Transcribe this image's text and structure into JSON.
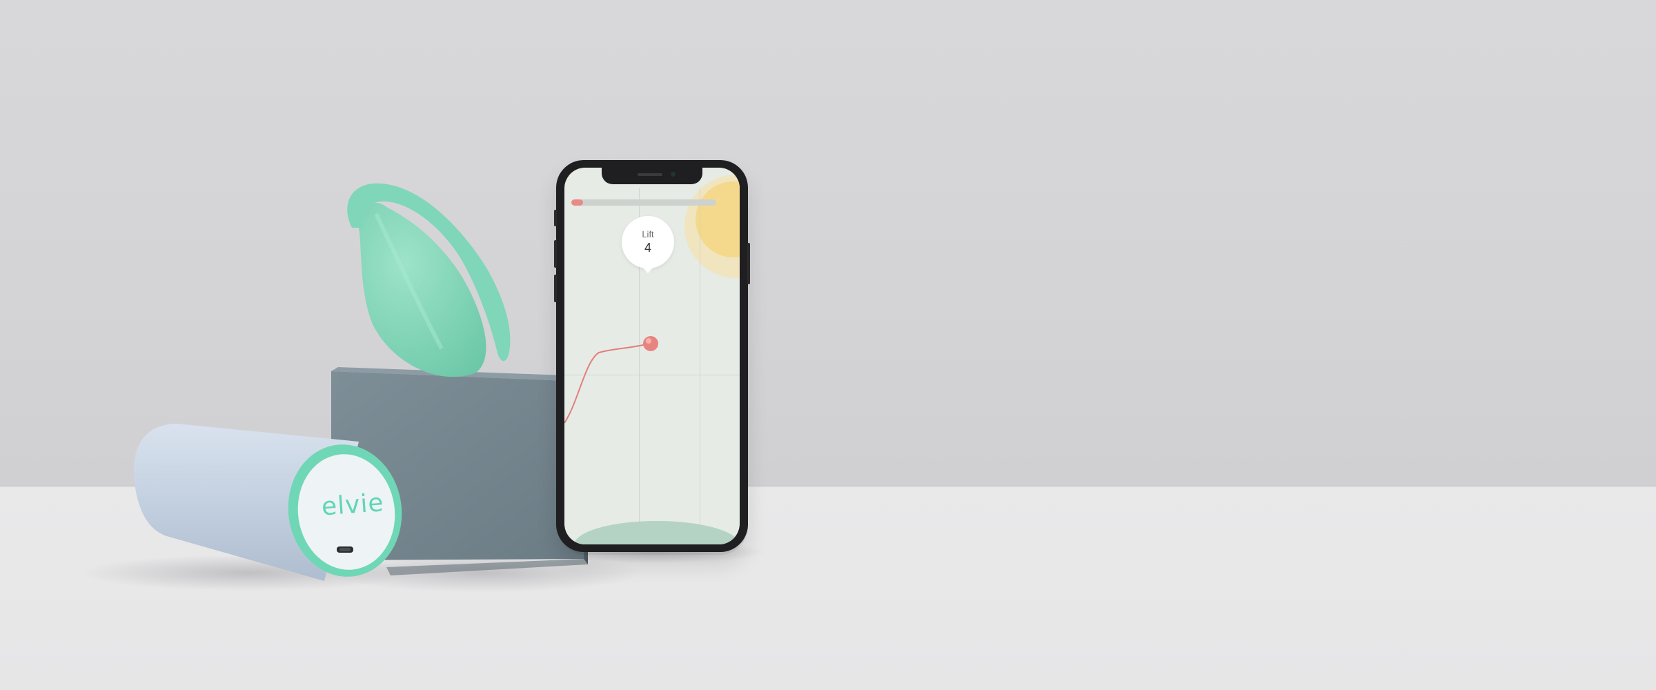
{
  "scene": {
    "colors": {
      "wall": "#d6d6d8",
      "floor": "#e8e8e9",
      "mint": "#7fd6b8",
      "cube": "#6f7f88",
      "cylinder": "#c6d3e3",
      "accent_red": "#e27e7a",
      "sun": "#f4d98d"
    }
  },
  "product": {
    "logo": "elvie"
  },
  "phone_app": {
    "badge_label": "Lift",
    "badge_value": "4",
    "progress": 0.08
  }
}
